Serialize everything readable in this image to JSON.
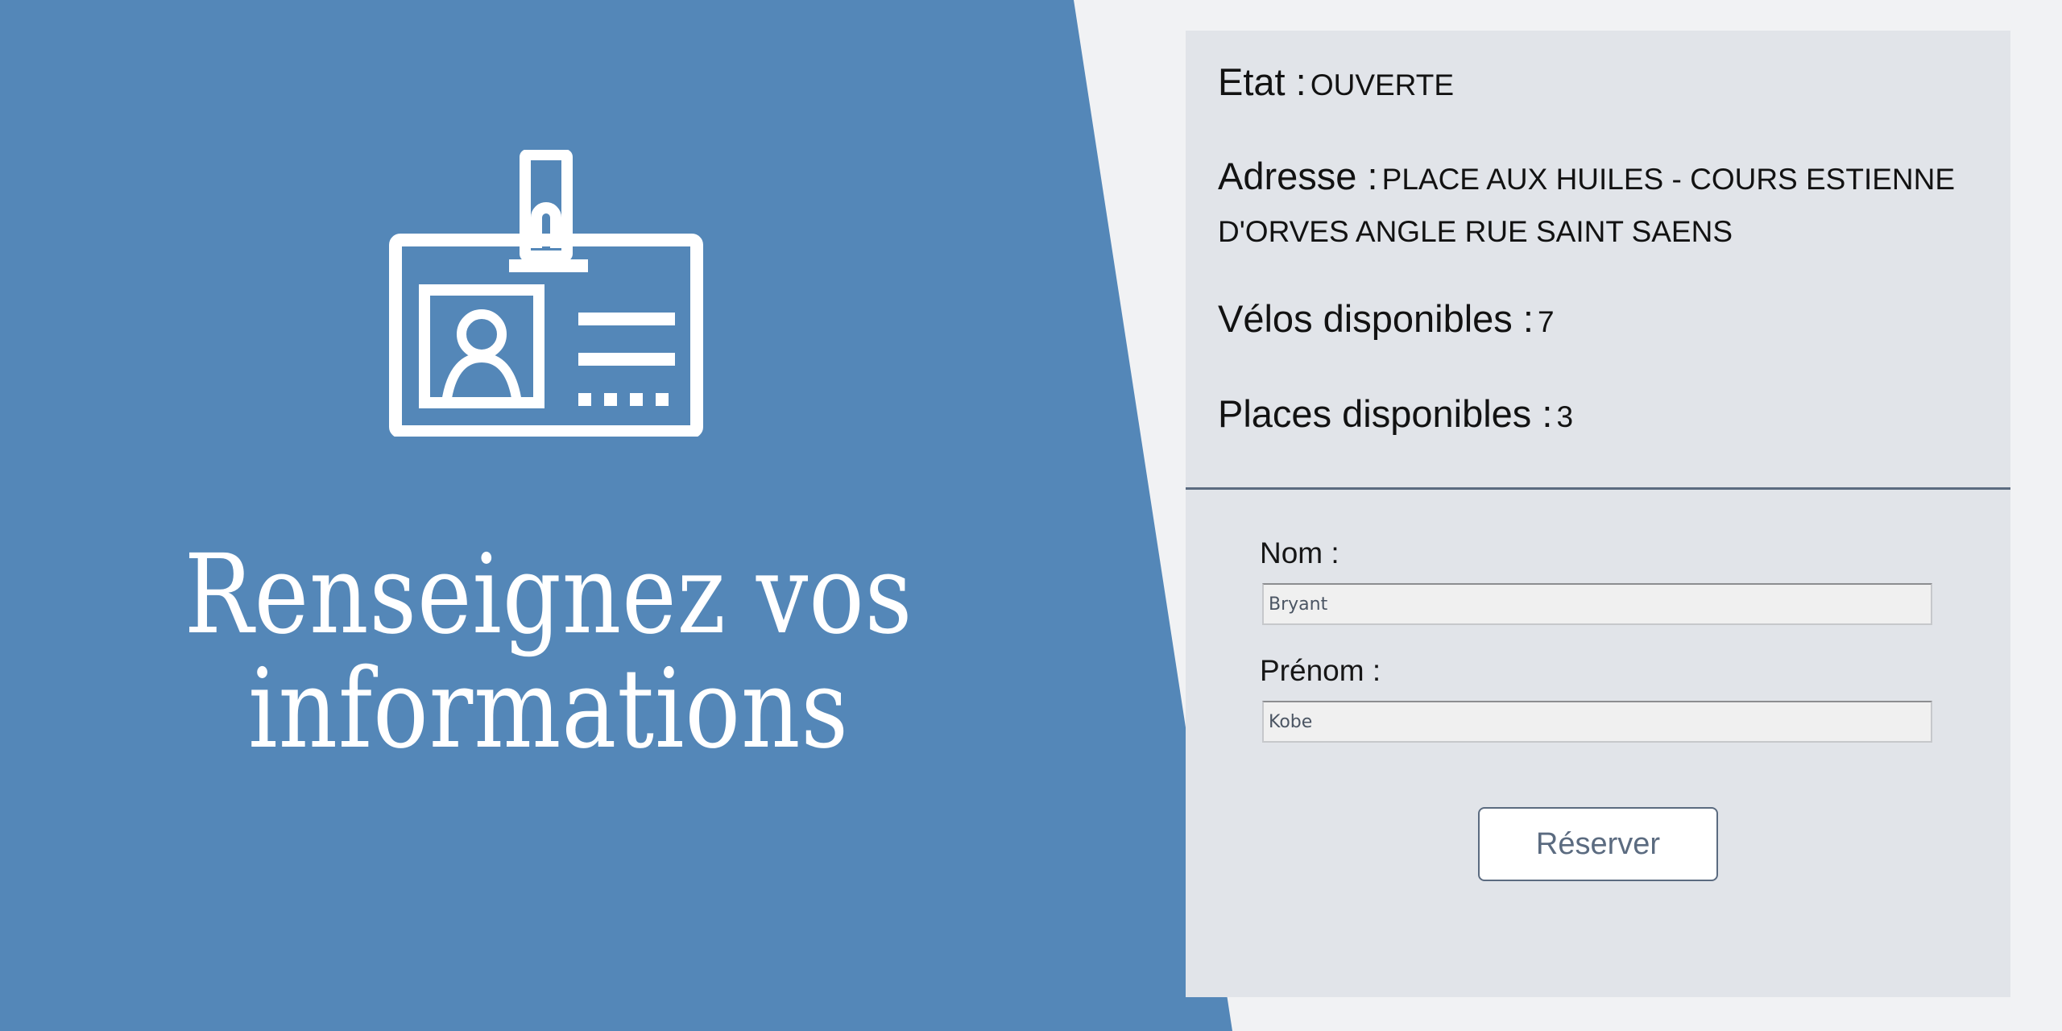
{
  "hero": {
    "title_line1": "Renseignez vos",
    "title_line2": "informations",
    "icon": "id-badge-icon"
  },
  "station": {
    "etat_label": "Etat :",
    "etat_value": "OUVERTE",
    "adresse_label": "Adresse :",
    "adresse_value": "PLACE AUX HUILES - COURS ESTIENNE D'ORVES ANGLE RUE SAINT SAENS",
    "velos_label": "Vélos disponibles :",
    "velos_value": "7",
    "places_label": "Places disponibles :",
    "places_value": "3"
  },
  "form": {
    "nom_label": "Nom :",
    "nom_value": "Bryant",
    "prenom_label": "Prénom :",
    "prenom_value": "Kobe",
    "submit_label": "Réserver"
  },
  "colors": {
    "hero_blue": "#5487b8",
    "card_bg": "#e1e4e9",
    "page_bg": "#f1f2f4",
    "accent_slate": "#5b6b80"
  }
}
